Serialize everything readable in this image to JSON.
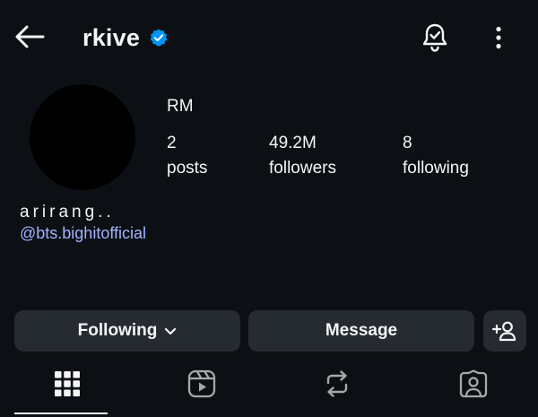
{
  "header": {
    "username": "rkive",
    "verified": true,
    "icons": {
      "back": "arrow-left-icon",
      "notifications": "bell-check-icon",
      "more": "more-vertical-icon"
    }
  },
  "profile": {
    "display_name": "RM",
    "stats": [
      {
        "value": "2",
        "label": "posts"
      },
      {
        "value": "49.2M",
        "label": "followers"
      },
      {
        "value": "8",
        "label": "following"
      }
    ],
    "bio": "arirang..",
    "link": "@bts.bighitofficial"
  },
  "actions": {
    "following_label": "Following",
    "message_label": "Message",
    "add_user_icon": "person-add-icon"
  },
  "tabs": [
    {
      "name": "posts",
      "icon": "grid-icon",
      "active": true
    },
    {
      "name": "reels",
      "icon": "reels-icon",
      "active": false
    },
    {
      "name": "reposts",
      "icon": "repost-icon",
      "active": false
    },
    {
      "name": "tagged",
      "icon": "tagged-icon",
      "active": false
    }
  ],
  "colors": {
    "background": "#0c1014",
    "button": "#262a31",
    "link": "#a0b4ff",
    "verified": "#0095f6"
  }
}
